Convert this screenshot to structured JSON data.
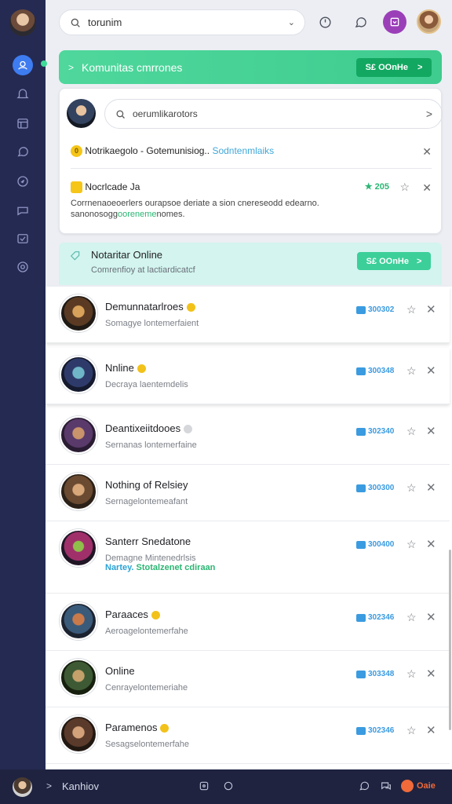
{
  "search": {
    "value": "torunim"
  },
  "banner": {
    "title": "Komunitas cmrrones",
    "button_label": "S£ OOnHe",
    "button_arrow": ">"
  },
  "card": {
    "search_value": "oerumlikarotors",
    "notif1": {
      "badge": "0",
      "title": "Notrikaegolo",
      "middle": " - Gotemunisiog..",
      "link": "Sodntenmlaiks"
    },
    "notif2": {
      "title": "Nocrlcade",
      "title_extra": "Ja",
      "stat": "205",
      "line1": "Corrnenaoeoerlers ourapsoe deriate a sion cnereseodd edearno.",
      "line2_prefix": "sanonosogg",
      "line2_green": "ooreneme",
      "line2_suffix": "nomes."
    }
  },
  "online": {
    "title": "Notaritar Online",
    "subtitle": "Comrenfioy at lactiardicatcf",
    "button_label": "S£ OOnHe",
    "button_arrow": ">"
  },
  "rows": [
    {
      "name": "Demunnatarlroes",
      "sub": "Somagye lontemerfaient",
      "count": "300302"
    },
    {
      "name": "Nnline",
      "sub": "Decraya laentemdelis",
      "count": "300348"
    },
    {
      "name": "Deantixeiitdooes",
      "sub": "Sernanas lontemerfaine",
      "count": "302340"
    },
    {
      "name": "Nothing of Relsiey",
      "sub": "Sernagelontemeafant",
      "count": "300300"
    },
    {
      "name": "Santerr Snedatone",
      "sub": "Demagne Mintenedrlsis",
      "sub2_prefix": "Nartey.",
      "sub2_green": "Stotalzenet cdiraan",
      "count": "300400"
    },
    {
      "name": "Paraaces",
      "sub": "Aeroagelontemerfahe",
      "count": "302346"
    },
    {
      "name": "Online",
      "sub": "Cenrayelontemeriahe",
      "count": "303348"
    },
    {
      "name": "Paramenos",
      "sub": "Sesagselontemerfahe",
      "count": "302346"
    }
  ],
  "bottom": {
    "arrow": ">",
    "label": "Kanhiov",
    "live_label": "Oaie"
  },
  "colors": {
    "sidebar": "#252a52",
    "accent_green": "#3fcc8f",
    "accent_blue": "#3e7cf1",
    "teal_card": "#d3f4ef"
  }
}
